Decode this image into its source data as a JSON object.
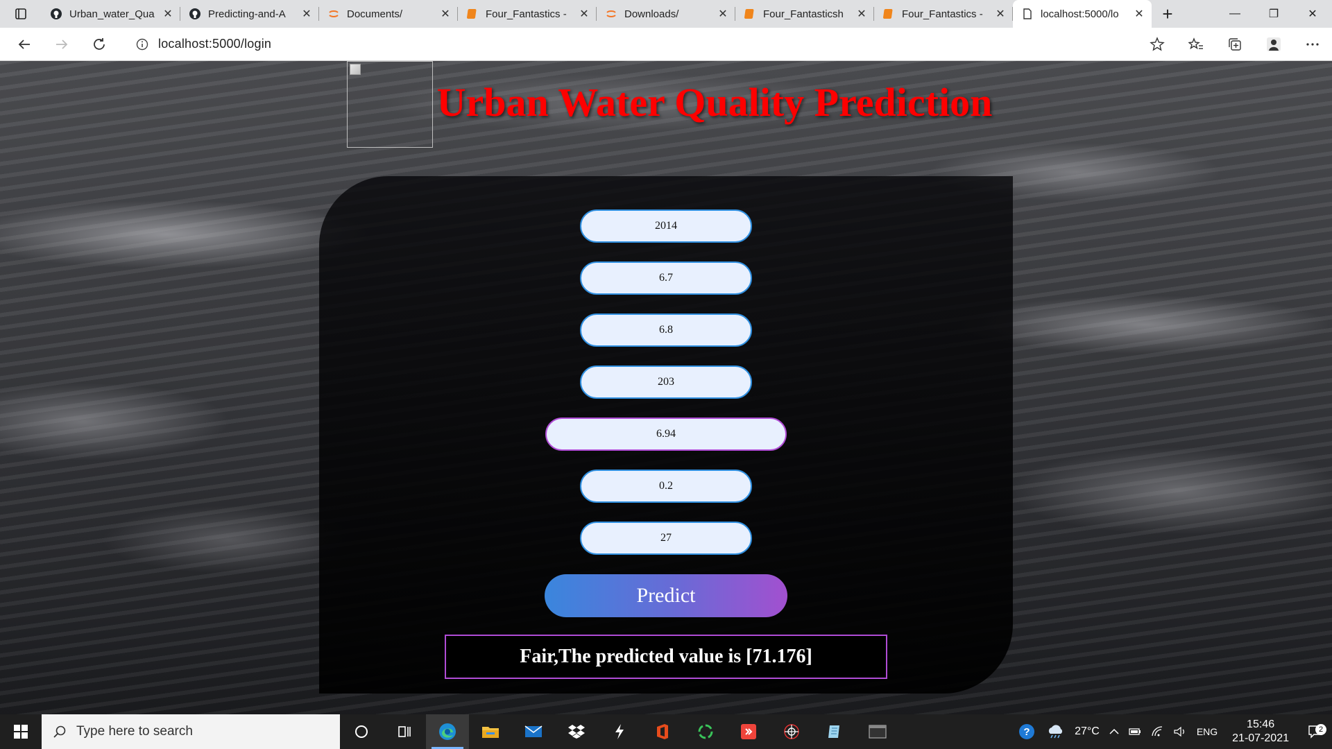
{
  "browser": {
    "tabs": [
      {
        "title": "Urban_water_Qua",
        "icon": "github-icon",
        "active": false
      },
      {
        "title": "Predicting-and-A",
        "icon": "github-icon",
        "active": false
      },
      {
        "title": "Documents/",
        "icon": "jupyter-icon",
        "active": false
      },
      {
        "title": "Four_Fantastics -",
        "icon": "notebook-icon",
        "active": false
      },
      {
        "title": "Downloads/",
        "icon": "jupyter-icon",
        "active": false
      },
      {
        "title": "Four_Fantasticsh",
        "icon": "notebook-icon",
        "active": false
      },
      {
        "title": "Four_Fantastics -",
        "icon": "notebook-icon",
        "active": false
      },
      {
        "title": "localhost:5000/lo",
        "icon": "page-icon",
        "active": true
      }
    ],
    "close_glyph": "✕",
    "new_tab_glyph": "+",
    "url": "localhost:5000/login"
  },
  "page": {
    "title": "Urban Water Quality Prediction",
    "fields": [
      {
        "value": "2014",
        "focused": false
      },
      {
        "value": "6.7",
        "focused": false
      },
      {
        "value": "6.8",
        "focused": false
      },
      {
        "value": "203",
        "focused": false
      },
      {
        "value": "6.94",
        "focused": true
      },
      {
        "value": "0.2",
        "focused": false
      },
      {
        "value": "27",
        "focused": false
      }
    ],
    "predict_label": "Predict",
    "result_text": "Fair,The predicted value is [71.176]"
  },
  "taskbar": {
    "search_placeholder": "Type here to search",
    "weather": "27°C",
    "language": "ENG",
    "time": "15:46",
    "date": "21-07-2021",
    "notification_count": "2"
  },
  "colors": {
    "title_red": "#ff0000",
    "field_border": "#2f8fe0",
    "focus_border": "#b04cd6",
    "button_gradient_start": "#3a86dd",
    "button_gradient_end": "#a250cf"
  }
}
